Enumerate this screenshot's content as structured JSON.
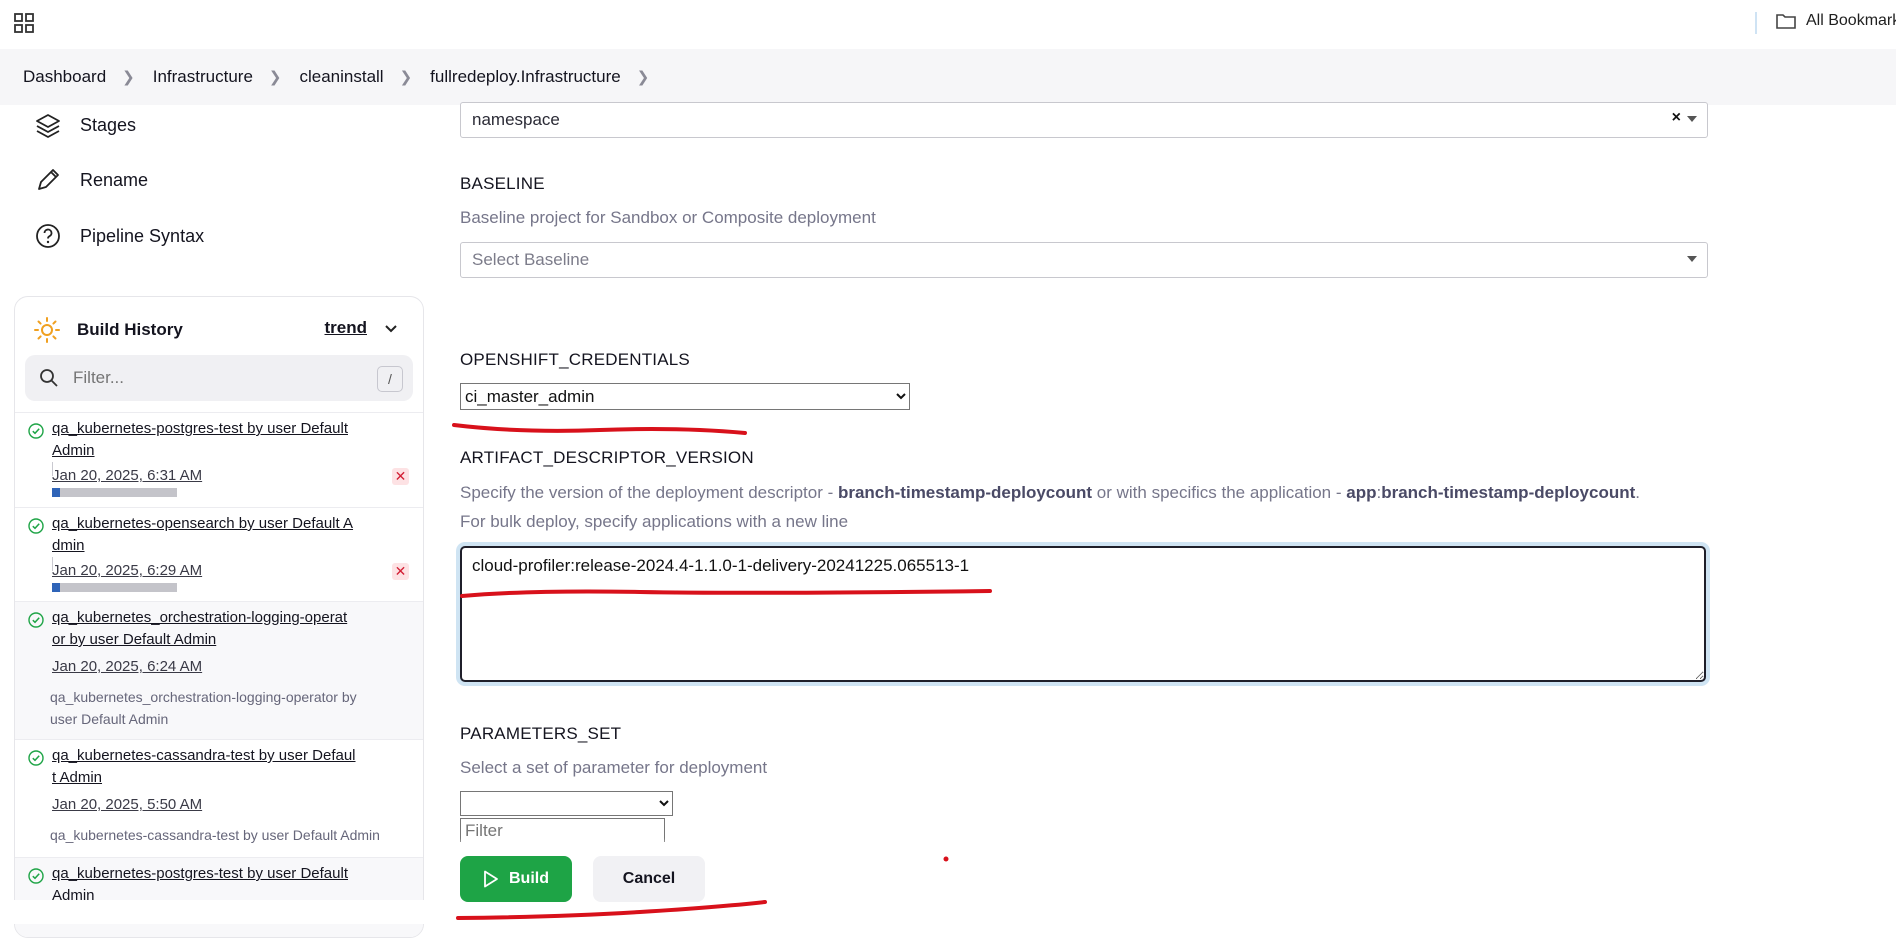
{
  "browser": {
    "bookmarks_label": "All Bookmark"
  },
  "breadcrumb": [
    "Dashboard",
    "Infrastructure",
    "cleaninstall",
    "fullredeploy.Infrastructure"
  ],
  "nav": [
    {
      "label": "Stages",
      "icon": "layers-icon"
    },
    {
      "label": "Rename",
      "icon": "pencil-icon"
    },
    {
      "label": "Pipeline Syntax",
      "icon": "help-circle-icon"
    }
  ],
  "build_history": {
    "title": "Build History",
    "trend_label": "trend",
    "filter_placeholder": "Filter...",
    "filter_shortcut": "/",
    "builds": [
      {
        "title_l1": "qa_kubernetes-postgres-test by user Default",
        "title_l2": "Admin",
        "time": "Jan 20, 2025, 6:31 AM",
        "progress": 0.06,
        "cancelable": true,
        "desc_l1": "",
        "desc_l2": ""
      },
      {
        "title_l1": "qa_kubernetes-opensearch by user Default A",
        "title_l2": "dmin",
        "time": "Jan 20, 2025, 6:29 AM",
        "progress": 0.06,
        "cancelable": true,
        "desc_l1": "",
        "desc_l2": ""
      },
      {
        "title_l1": "qa_kubernetes_orchestration-logging-operat",
        "title_l2": "or by user Default Admin",
        "time": "Jan 20, 2025, 6:24 AM",
        "progress": null,
        "cancelable": false,
        "desc_l1": "qa_kubernetes_orchestration-logging-operator by",
        "desc_l2": "user Default Admin"
      },
      {
        "title_l1": "qa_kubernetes-cassandra-test by user Defaul",
        "title_l2": "t Admin",
        "time": "Jan 20, 2025, 5:50 AM",
        "progress": null,
        "cancelable": false,
        "desc_l1": "qa_kubernetes-cassandra-test by user Default Admin",
        "desc_l2": ""
      },
      {
        "title_l1": "qa_kubernetes-postgres-test by user Default",
        "title_l2": "Admin",
        "time": "",
        "progress": null,
        "cancelable": false,
        "desc_l1": "",
        "desc_l2": ""
      }
    ]
  },
  "form": {
    "namespace": {
      "value": "namespace",
      "clear": "×"
    },
    "baseline": {
      "label": "BASELINE",
      "description": "Baseline project for Sandbox or Composite deployment",
      "placeholder": "Select Baseline"
    },
    "openshift": {
      "label": "OPENSHIFT_CREDENTIALS",
      "value": "ci_master_admin"
    },
    "artifact": {
      "label": "ARTIFACT_DESCRIPTOR_VERSION",
      "desc_a": "Specify the version of the deployment descriptor - ",
      "desc_b": "branch-timestamp-deploycount",
      "desc_c": " or with specifics the application - ",
      "desc_d": "app",
      "desc_e": ":",
      "desc_f": "branch-timestamp-deploycount",
      "desc_g": ".",
      "desc_line2": "For bulk deploy, specify applications with a new line",
      "value": "cloud-profiler:release-2024.4-1.1.0-1-delivery-20241225.065513-1"
    },
    "parameters_set": {
      "label": "PARAMETERS_SET",
      "description": "Select a set of parameter for deployment",
      "value": "",
      "filter_placeholder": "Filter"
    }
  },
  "actions": {
    "build_label": "Build",
    "cancel_label": "Cancel"
  },
  "colors": {
    "build_green": "#1ea446",
    "annotation_red": "#d8111b",
    "focus_ring": "#cfe4f3"
  }
}
